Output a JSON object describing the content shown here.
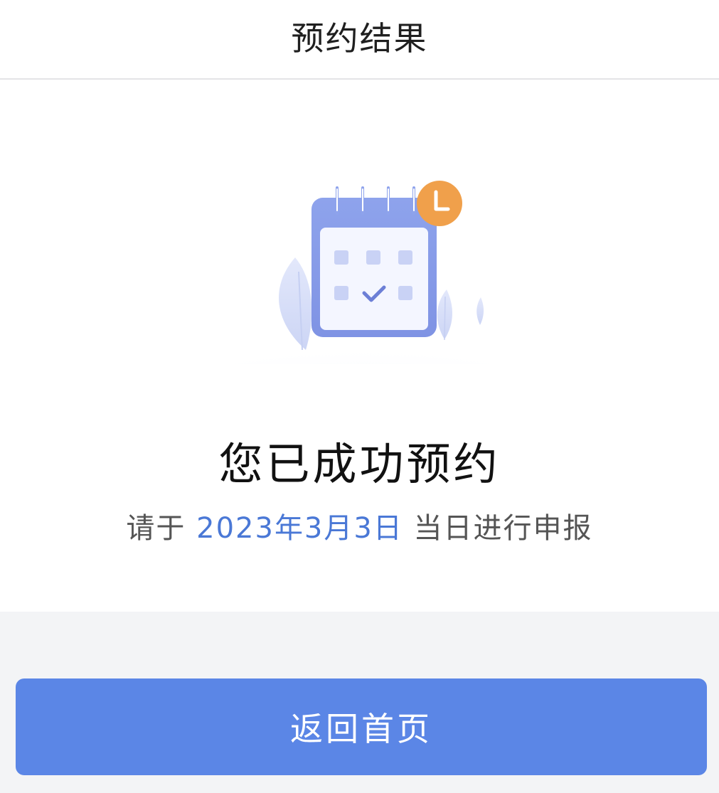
{
  "header": {
    "title": "预约结果"
  },
  "result": {
    "title": "您已成功预约",
    "sub_prefix": "请于 ",
    "date": "2023年3月3日",
    "sub_suffix": " 当日进行申报"
  },
  "illustration": {
    "icon": "calendar-check-icon",
    "badge_icon": "clock-icon"
  },
  "actions": {
    "back_home_label": "返回首页"
  },
  "colors": {
    "accent": "#5b86e6",
    "date_text": "#4a78d6",
    "badge": "#f0a04b",
    "page_bg": "#f3f4f6"
  }
}
